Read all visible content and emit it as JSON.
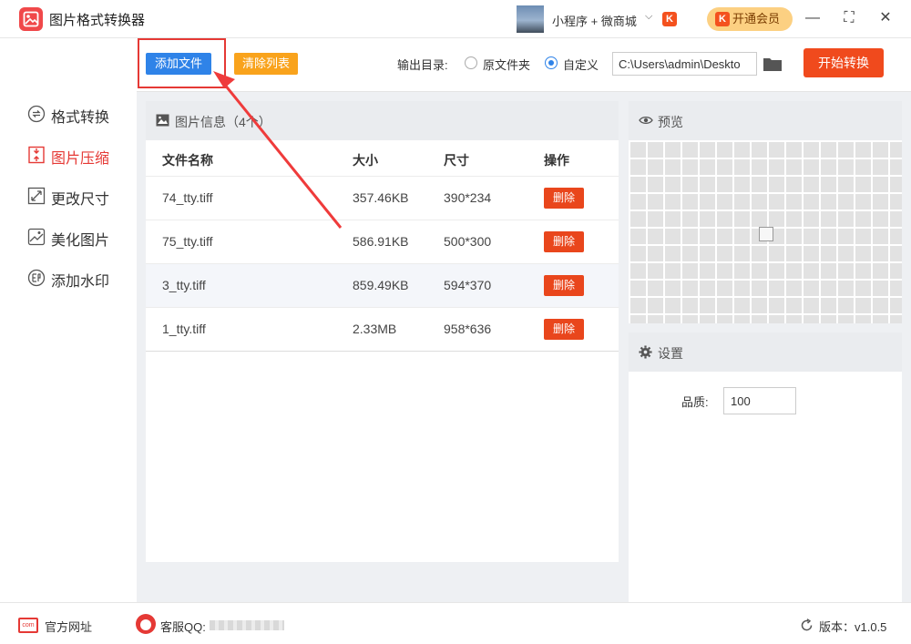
{
  "app": {
    "title": "图片格式转换器",
    "mini_program": "小程序 + 微商城",
    "vip_label": "开通会员",
    "k_badge": "K"
  },
  "window": {
    "minimize": "—",
    "maximize": "⛶",
    "close": "✕"
  },
  "sidebar": {
    "items": [
      {
        "label": "格式转换",
        "icon": "format-convert-icon",
        "active": false
      },
      {
        "label": "图片压缩",
        "icon": "compress-icon",
        "active": true
      },
      {
        "label": "更改尺寸",
        "icon": "resize-icon",
        "active": false
      },
      {
        "label": "美化图片",
        "icon": "beautify-icon",
        "active": false
      },
      {
        "label": "添加水印",
        "icon": "watermark-icon",
        "active": false
      }
    ]
  },
  "toolbar": {
    "add_label": "添加文件",
    "clear_label": "清除列表",
    "output_label": "输出目录:",
    "option_original": "原文件夹",
    "option_custom": "自定义",
    "selected_option": "自定义",
    "path_value": "C:\\Users\\admin\\Deskto",
    "start_label": "开始转换"
  },
  "files": {
    "header_title": "图片信息（4个）",
    "columns": [
      "文件名称",
      "大小",
      "尺寸",
      "操作"
    ],
    "rows": [
      {
        "name": "74_tty.tiff",
        "size": "357.46KB",
        "dims": "390*234",
        "action": "删除"
      },
      {
        "name": "75_tty.tiff",
        "size": "586.91KB",
        "dims": "500*300",
        "action": "删除"
      },
      {
        "name": "3_tty.tiff",
        "size": "859.49KB",
        "dims": "594*370",
        "action": "删除"
      },
      {
        "name": "1_tty.tiff",
        "size": "2.33MB",
        "dims": "958*636",
        "action": "删除"
      }
    ]
  },
  "preview": {
    "title": "预览"
  },
  "settings": {
    "title": "设置",
    "quality_label": "品质:",
    "quality_value": "100"
  },
  "status": {
    "site_label": "官方网址",
    "site_icon_text": "com",
    "service_label": "客服QQ:",
    "version": "版本：v1.0.5"
  },
  "colors": {
    "accent_red": "#e53935",
    "add_blue": "#2f83e8",
    "clear_orange": "#f9a31c",
    "start_orange": "#f04a1d"
  }
}
